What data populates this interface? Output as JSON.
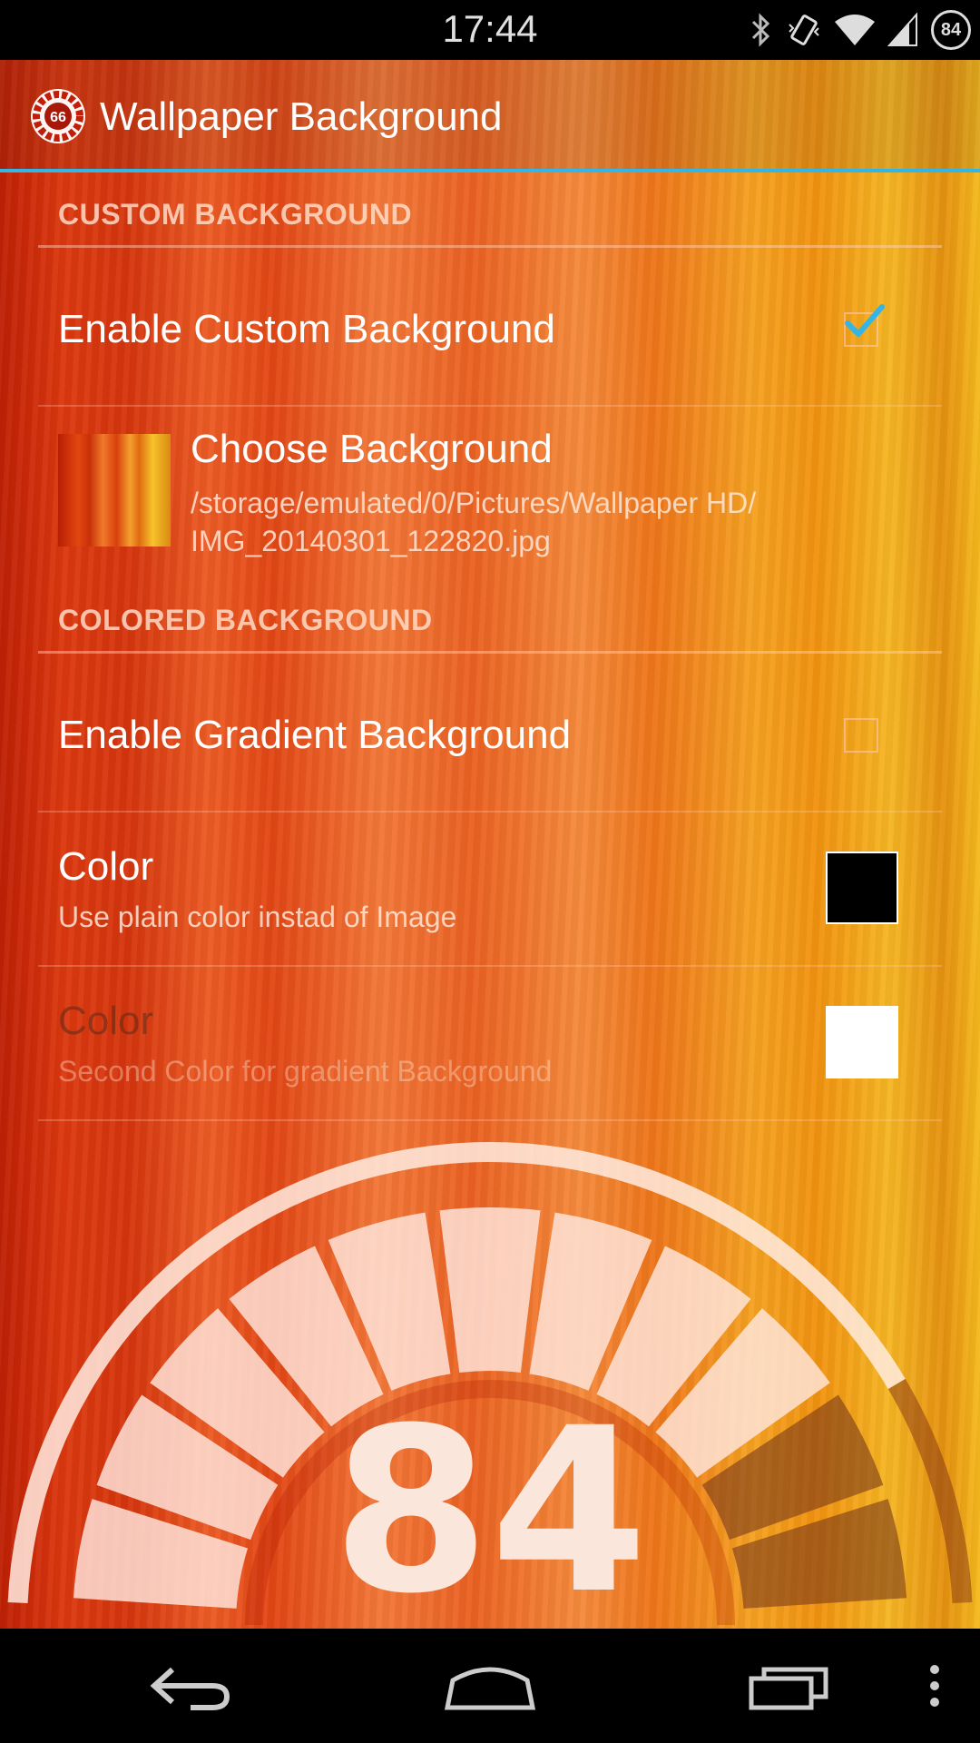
{
  "status_bar": {
    "time": "17:44",
    "battery_level": "84",
    "icons": [
      "bluetooth-icon",
      "vibrate-icon",
      "wifi-icon",
      "cell-signal-icon",
      "battery-icon"
    ]
  },
  "action_bar": {
    "title": "Wallpaper Background",
    "app_icon_badge": "66",
    "accent_color": "#33b5e5"
  },
  "sections": {
    "custom": {
      "header": "CUSTOM BACKGROUND",
      "enable_title": "Enable Custom Background",
      "enable_checked": true,
      "choose_title": "Choose Background",
      "choose_path_line1": "/storage/emulated/0/Pictures/Wallpaper HD/",
      "choose_path_line2": "IMG_20140301_122820.jpg"
    },
    "colored": {
      "header": "COLORED BACKGROUND",
      "gradient_title": "Enable Gradient Background",
      "gradient_checked": false,
      "color1_title": "Color",
      "color1_summary": "Use plain color instad of Image",
      "color1_value": "#000000",
      "color2_title": "Color",
      "color2_summary": "Second Color for gradient Background",
      "color2_value": "#ffffff"
    }
  },
  "gauge": {
    "value": "84",
    "level_percent": 84
  },
  "nav_bar": {
    "buttons": [
      "back-icon",
      "home-icon",
      "recents-icon",
      "overflow-menu-icon"
    ]
  }
}
